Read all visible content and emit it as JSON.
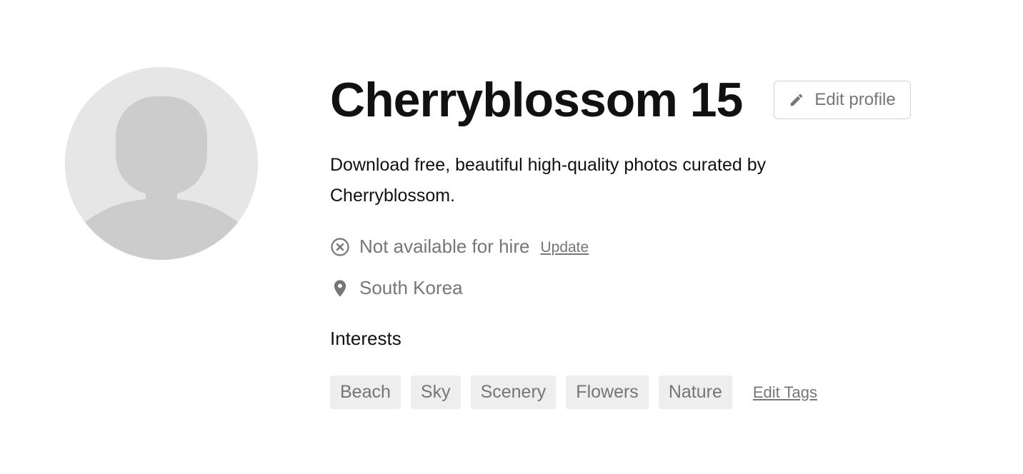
{
  "profile": {
    "display_name": "Cherryblossom 15",
    "edit_profile_label": "Edit profile",
    "bio": "Download free, beautiful high-quality photos curated by Cherryblossom.",
    "hire_status": "Not available for hire",
    "update_label": "Update",
    "location": "South Korea",
    "interests_heading": "Interests",
    "tags": [
      "Beach",
      "Sky",
      "Scenery",
      "Flowers",
      "Nature"
    ],
    "edit_tags_label": "Edit Tags"
  },
  "icons": {
    "avatar": "default-user-avatar",
    "edit": "pencil-icon",
    "hire": "circle-x-icon",
    "location": "map-pin-icon"
  },
  "colors": {
    "title_text": "#111111",
    "muted_text": "#767676",
    "tag_background": "#eeeeee",
    "avatar_background": "#e6e6e6",
    "avatar_silhouette": "#cccccc",
    "button_border": "#d1d1d1"
  }
}
